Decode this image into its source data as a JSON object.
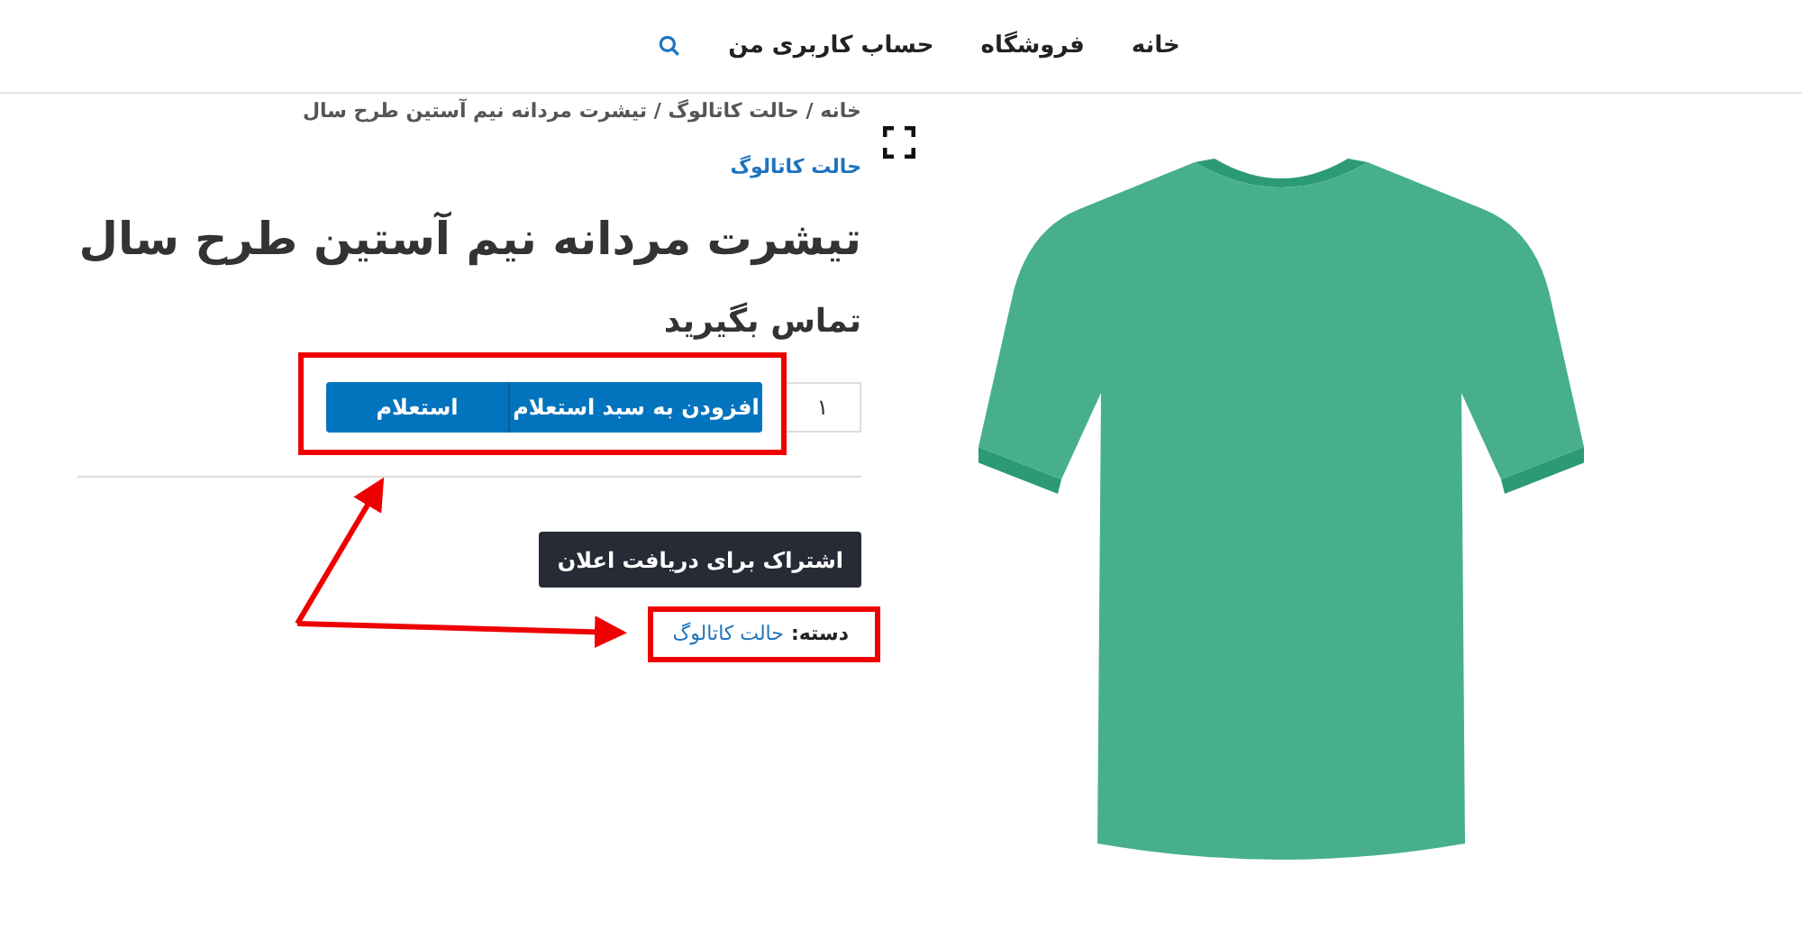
{
  "nav": {
    "items": [
      "خانه",
      "فروشگاه",
      "حساب کاربری من"
    ]
  },
  "breadcrumb": "خانه / حالت کاتالوگ / تیشرت مردانه نیم آستین طرح سال",
  "category_link": "حالت کاتالوگ",
  "title": "تیشرت مردانه نیم آستین طرح سال",
  "price_text": "تماس بگیرید",
  "quantity": "۱",
  "buttons": [
    {
      "label": "افزودن به سبد استعلام"
    },
    {
      "label": "استعلام"
    }
  ],
  "subscribe_button": "اشتراک برای دریافت اعلان",
  "category": {
    "label": "دسته:",
    "value": "حالت کاتالوگ"
  }
}
